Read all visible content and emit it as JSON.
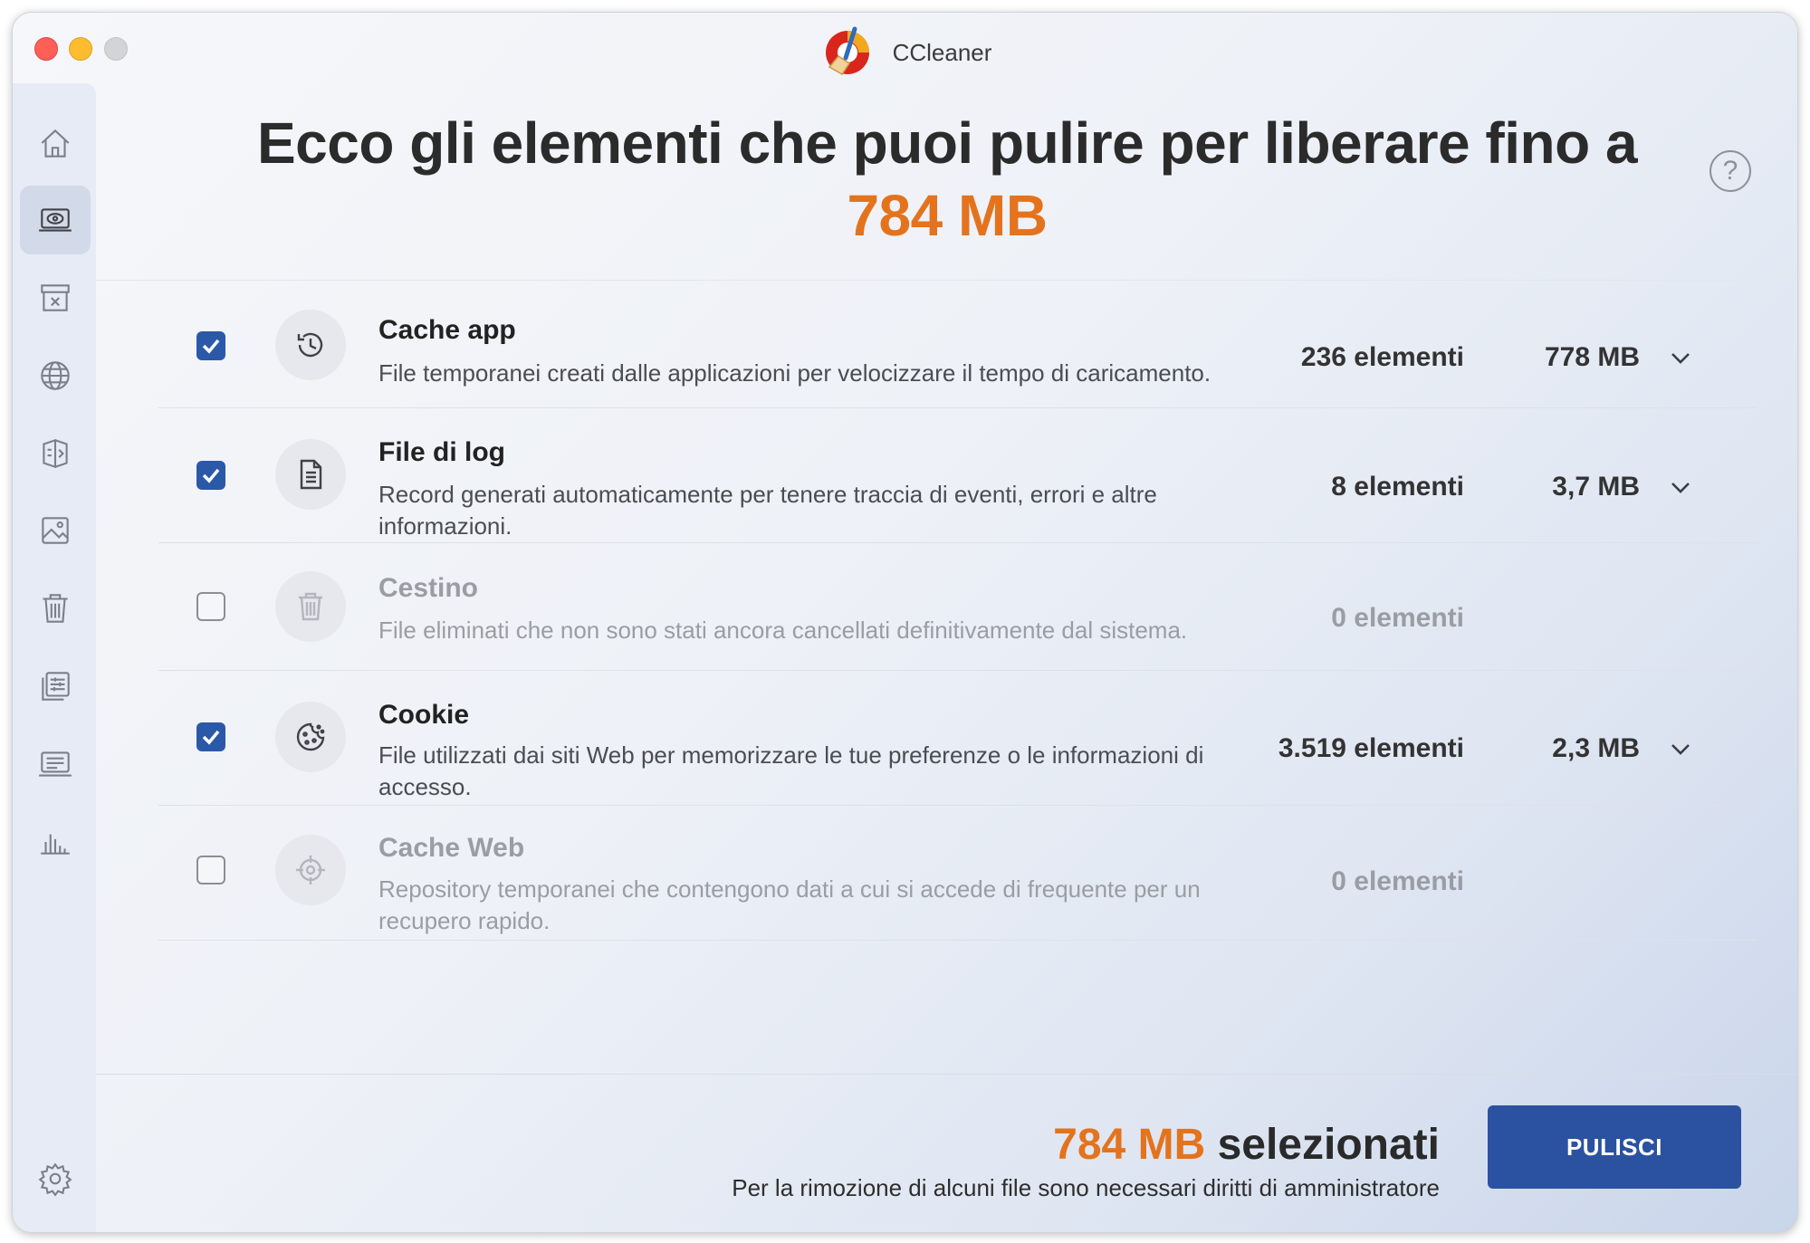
{
  "window": {
    "app_name": "CCleaner"
  },
  "sidebar": {
    "items": [
      {
        "name": "home",
        "icon": "home-icon"
      },
      {
        "name": "cleaner",
        "icon": "laptop-eye-icon",
        "active": true
      },
      {
        "name": "uninstaller",
        "icon": "archive-x-icon"
      },
      {
        "name": "browser",
        "icon": "globe-icon"
      },
      {
        "name": "duplicates",
        "icon": "duplicate-files-icon"
      },
      {
        "name": "photos",
        "icon": "image-icon"
      },
      {
        "name": "trash",
        "icon": "trash-icon"
      },
      {
        "name": "startup",
        "icon": "list-sliders-icon"
      },
      {
        "name": "system",
        "icon": "monitor-text-icon"
      },
      {
        "name": "performance",
        "icon": "bar-chart-icon"
      }
    ],
    "settings_icon": "gear-icon"
  },
  "header": {
    "headline": "Ecco gli elementi che puoi pulire per liberare fino a",
    "amount": "784 MB",
    "help": "?"
  },
  "rows": [
    {
      "checked": true,
      "icon": "history-icon",
      "title": "Cache app",
      "description": "File temporanei creati dalle applicazioni per velocizzare il tempo di caricamento.",
      "count": "236 elementi",
      "size": "778 MB",
      "expandable": true
    },
    {
      "checked": true,
      "icon": "document-icon",
      "title": "File di log",
      "description": "Record generati automaticamente per tenere traccia di eventi, errori e altre informazioni.",
      "count": "8 elementi",
      "size": "3,7 MB",
      "expandable": true
    },
    {
      "checked": false,
      "icon": "trash-icon",
      "title": "Cestino",
      "description": "File eliminati che non sono stati ancora cancellati definitivamente dal sistema.",
      "count": "0 elementi",
      "size": "",
      "expandable": false
    },
    {
      "checked": true,
      "icon": "cookie-icon",
      "title": "Cookie",
      "description": "File utilizzati dai siti Web per memorizzare le tue preferenze o le informazioni di accesso.",
      "count": "3.519 elementi",
      "size": "2,3 MB",
      "expandable": true
    },
    {
      "checked": false,
      "icon": "target-icon",
      "title": "Cache Web",
      "description": "Repository temporanei che contengono dati a cui si accede di frequente per un recupero rapido.",
      "count": "0 elementi",
      "size": "",
      "expandable": false
    }
  ],
  "footer": {
    "selected_amount": "784 MB",
    "selected_label": "selezionati",
    "admin_note": "Per la rimozione di alcuni file sono necessari diritti di amministratore",
    "clean_button": "PULISCI"
  },
  "colors": {
    "accent_orange": "#e4731d",
    "button_blue": "#2b52a0",
    "checkbox_blue": "#2b59a8"
  }
}
